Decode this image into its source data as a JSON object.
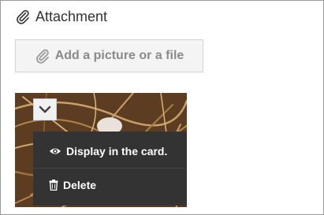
{
  "header": {
    "title": "Attachment",
    "icon": "paperclip-icon"
  },
  "add_button": {
    "label": "Add a picture or a file",
    "icon": "paperclip-icon"
  },
  "thumbnail": {
    "toggle_icon": "chevron-down-icon"
  },
  "menu": {
    "items": [
      {
        "label": "Display in the card.",
        "icon": "eye-icon"
      },
      {
        "label": "Delete",
        "icon": "trash-icon"
      }
    ]
  },
  "colors": {
    "menu_background": "#333333",
    "button_background": "#f4f4f4",
    "button_text": "#8a8a8a"
  }
}
